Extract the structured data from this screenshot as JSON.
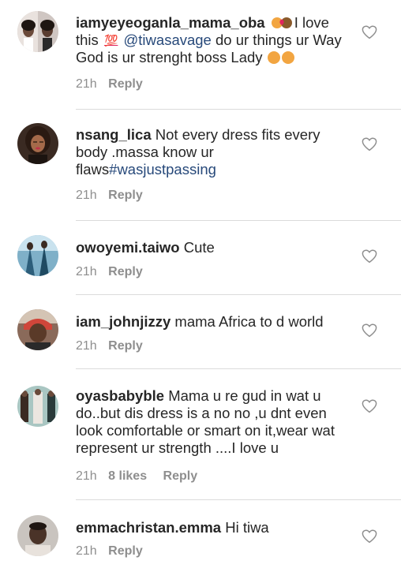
{
  "comments": [
    {
      "username": "iamyeyeoganla_mama_oba",
      "text_a": "I love this",
      "emoji_100": "💯",
      "mention": "@tiwasavage",
      "text_b": " do ur things ur Way God is ur strenght boss Lady",
      "time": "21h",
      "reply": "Reply",
      "avatar_icon": "profile-photo"
    },
    {
      "username": "nsang_lica",
      "text_a": "Not every dress fits every body .massa know ur flaws",
      "hashtag": "#wasjustpassing",
      "time": "21h",
      "reply": "Reply",
      "avatar_icon": "profile-photo"
    },
    {
      "username": "owoyemi.taiwo",
      "text_a": "Cute",
      "time": "21h",
      "reply": "Reply",
      "avatar_icon": "profile-photo"
    },
    {
      "username": "iam_johnjizzy",
      "text_a": "mama Africa to d world",
      "time": "21h",
      "reply": "Reply",
      "avatar_icon": "profile-photo"
    },
    {
      "username": "oyasbabyble",
      "text_a": "Mama u re gud in wat u do..but dis dress is a no no ,u dnt even look comfortable or smart on it,wear wat represent ur strength ....I love u",
      "time": "21h",
      "likes": "8 likes",
      "reply": "Reply",
      "avatar_icon": "profile-photo"
    },
    {
      "username": "emmachristan.emma",
      "text_a": "Hi tiwa",
      "time": "21h",
      "reply": "Reply",
      "avatar_icon": "profile-photo"
    }
  ],
  "like_icon": "heart-outline-icon",
  "colors": {
    "link": "#27497a",
    "meta": "#8e8e8e",
    "divider": "#dbdbdb"
  }
}
